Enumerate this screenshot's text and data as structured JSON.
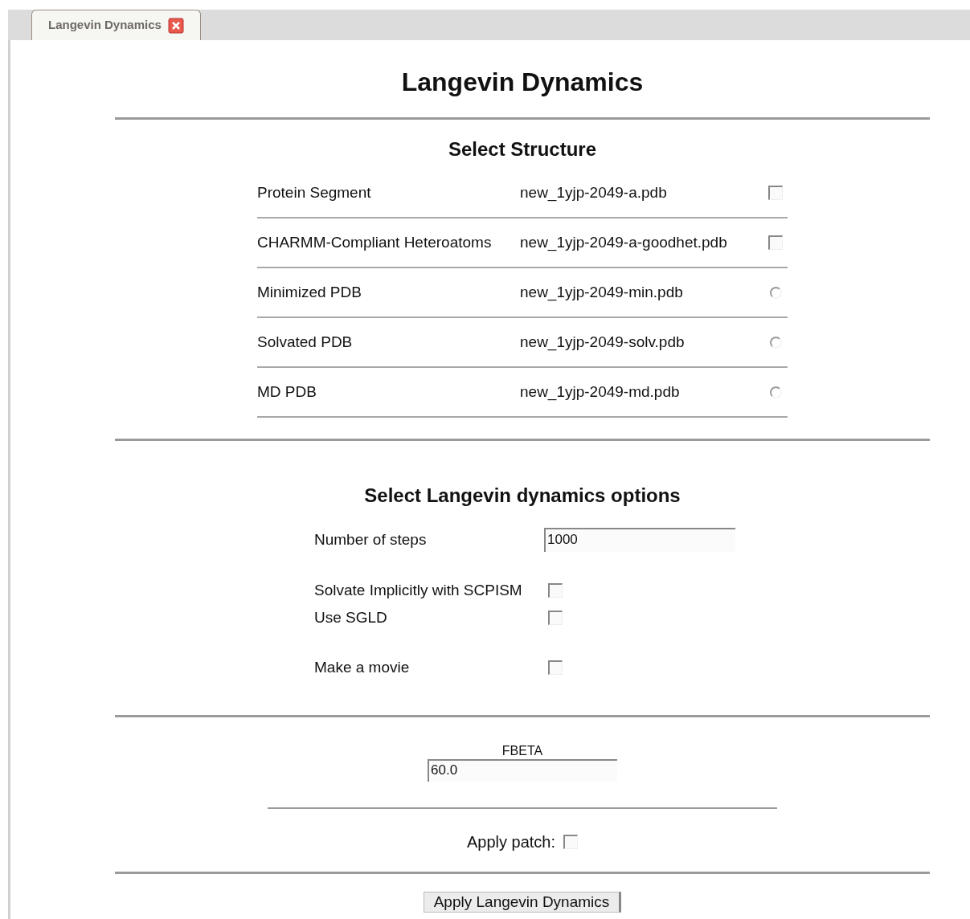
{
  "tabs": [
    {
      "label": "Langevin Dynamics",
      "selected": true
    }
  ],
  "title": "Langevin Dynamics",
  "structure": {
    "heading": "Select Structure",
    "rows": [
      {
        "label": "Protein Segment",
        "file": "new_1yjp-2049-a.pdb",
        "kind": "checkbox",
        "checked": false
      },
      {
        "label": "CHARMM-Compliant Heteroatoms",
        "file": "new_1yjp-2049-a-goodhet.pdb",
        "kind": "checkbox",
        "checked": false
      },
      {
        "label": "Minimized PDB",
        "file": "new_1yjp-2049-min.pdb",
        "kind": "radio",
        "checked": false
      },
      {
        "label": "Solvated PDB",
        "file": "new_1yjp-2049-solv.pdb",
        "kind": "radio",
        "checked": false
      },
      {
        "label": "MD PDB",
        "file": "new_1yjp-2049-md.pdb",
        "kind": "radio",
        "checked": false
      }
    ]
  },
  "options": {
    "heading": "Select Langevin dynamics options",
    "steps": {
      "label": "Number of steps",
      "value": "1000"
    },
    "checks": [
      {
        "label": "Solvate Implicitly with SCPISM",
        "checked": false
      },
      {
        "label": "Use SGLD",
        "checked": false
      },
      {
        "label": "Make a movie",
        "checked": false
      }
    ]
  },
  "fbeta": {
    "label": "FBETA",
    "value": "60.0"
  },
  "patch": {
    "label": "Apply patch:",
    "checked": false
  },
  "submit": "Apply Langevin Dynamics"
}
